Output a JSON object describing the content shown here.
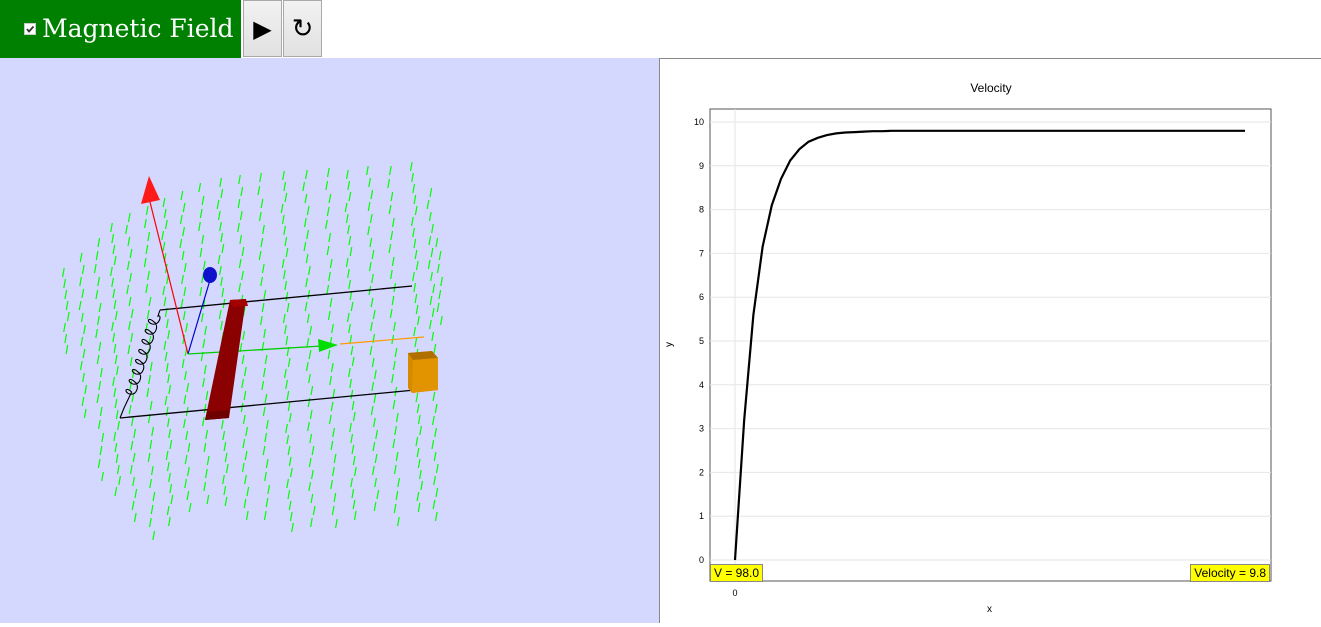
{
  "toolbar": {
    "toggle_label": "Magnetic Field",
    "toggle_checked": true,
    "play_glyph": "▶",
    "reset_glyph": "↻",
    "toggle_color": "#008000"
  },
  "scene": {
    "background": "#d4d8ff",
    "field_color": "#00ff00",
    "rod_color": "#8b0000",
    "block_color": "#d68a00"
  },
  "graph": {
    "title": "Velocity",
    "xlabel": "x",
    "ylabel": "y",
    "x_tick": "0",
    "left_readout": "V = 98.0",
    "right_readout": "Velocity = 9.8"
  },
  "chart_data": {
    "type": "line",
    "title": "Velocity",
    "xlabel": "x",
    "ylabel": "y",
    "ylim": [
      0,
      10
    ],
    "yticks": [
      0,
      1,
      2,
      3,
      4,
      5,
      6,
      7,
      8,
      9,
      10
    ],
    "xticks": [
      0
    ],
    "grid": true,
    "series": [
      {
        "values": [
          0,
          3.2,
          5.6,
          7.15,
          8.1,
          8.7,
          9.12,
          9.38,
          9.55,
          9.64,
          9.7,
          9.74,
          9.76,
          9.77,
          9.78,
          9.79,
          9.79,
          9.8,
          9.8,
          9.8,
          9.8
        ],
        "terminal": 9.8
      }
    ]
  }
}
